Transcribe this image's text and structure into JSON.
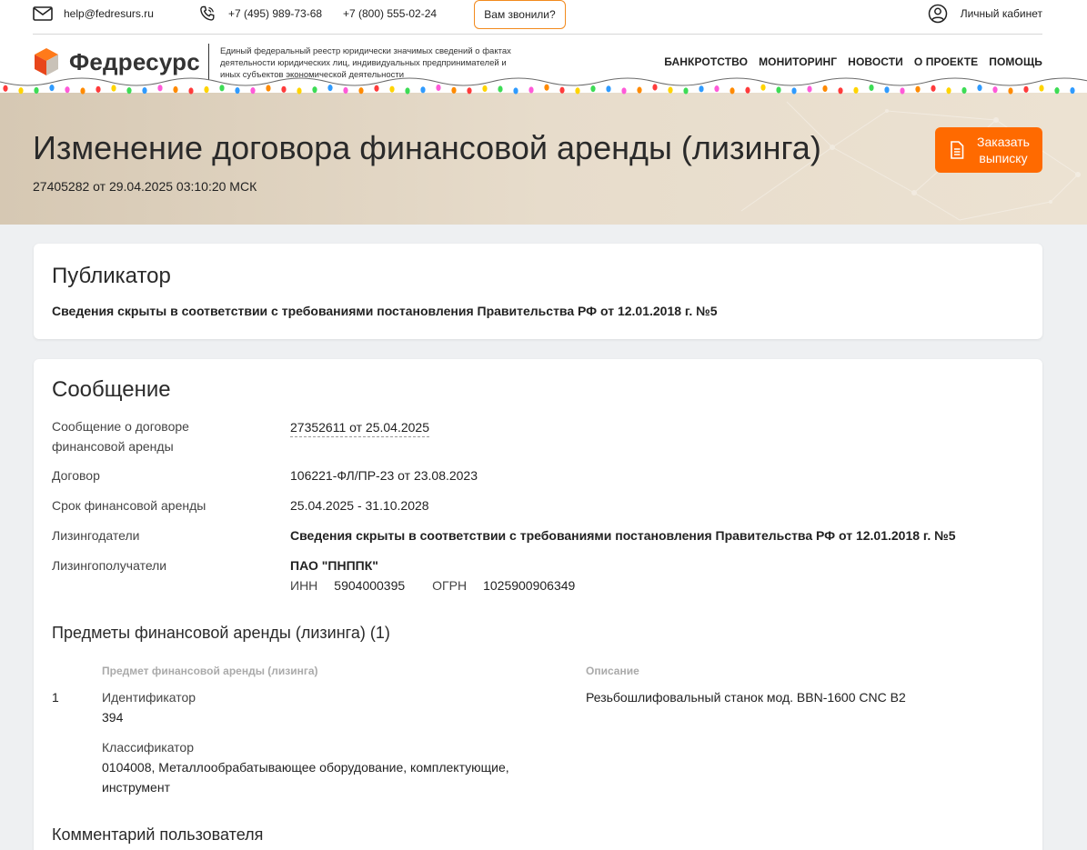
{
  "header": {
    "email": "help@fedresurs.ru",
    "phone1": "+7 (495) 989-73-68",
    "phone2": "+7 (800) 555-02-24",
    "call_button": "Вам звонили?",
    "cabinet": "Личный кабинет",
    "logo_name": "Федресурс",
    "logo_description": "Единый федеральный реестр юридически значимых сведений о фактах деятельности юридических лиц, индивидуальных предпринимателей и иных субъектов экономической деятельности",
    "nav": [
      "БАНКРОТСТВО",
      "МОНИТОРИНГ",
      "НОВОСТИ",
      "О ПРОЕКТЕ",
      "ПОМОЩЬ"
    ]
  },
  "hero": {
    "title": "Изменение договора финансовой аренды (лизинга)",
    "subtitle": "27405282 от 29.04.2025 03:10:20 МСК",
    "order_button": "Заказать выписку"
  },
  "publisher": {
    "title": "Публикатор",
    "text": "Сведения скрыты в соответствии с требованиями постановления Правительства РФ от 12.01.2018 г. №5"
  },
  "message": {
    "title": "Сообщение",
    "rows": [
      {
        "label": "Сообщение о договоре финансовой аренды",
        "value": "27352611 от 25.04.2025"
      },
      {
        "label": "Договор",
        "value": "106221-ФЛ/ПР-23 от 23.08.2023"
      },
      {
        "label": "Срок финансовой аренды",
        "value": "25.04.2025 - 31.10.2028"
      },
      {
        "label": "Лизингодатели",
        "value": "Сведения скрыты в соответствии с требованиями постановления Правительства РФ от 12.01.2018 г. №5"
      },
      {
        "label": "Лизингополучатели",
        "value": "ПАО \"ПНППК\""
      }
    ],
    "lessee_ids": {
      "inn_label": "ИНН",
      "inn": "5904000395",
      "ogrn_label": "ОГРН",
      "ogrn": "1025900906349"
    },
    "subjects_title": "Предметы финансовой аренды (лизинга) (1)",
    "subjects_headers": {
      "subject": "Предмет финансовой аренды (лизинга)",
      "description": "Описание"
    },
    "subjects": [
      {
        "num": "1",
        "id_label": "Идентификатор",
        "id_value": "394",
        "class_label": "Классификатор",
        "class_value": "0104008, Металлообрабатывающее оборудование, комплектующие, инструмент",
        "description": "Резьбошлифовальный станок мод. BBN-1600 CNC B2"
      }
    ],
    "comment_title": "Комментарий пользователя"
  },
  "colors": {
    "accent": "#ff6a00",
    "call_border": "#f28a1d"
  }
}
